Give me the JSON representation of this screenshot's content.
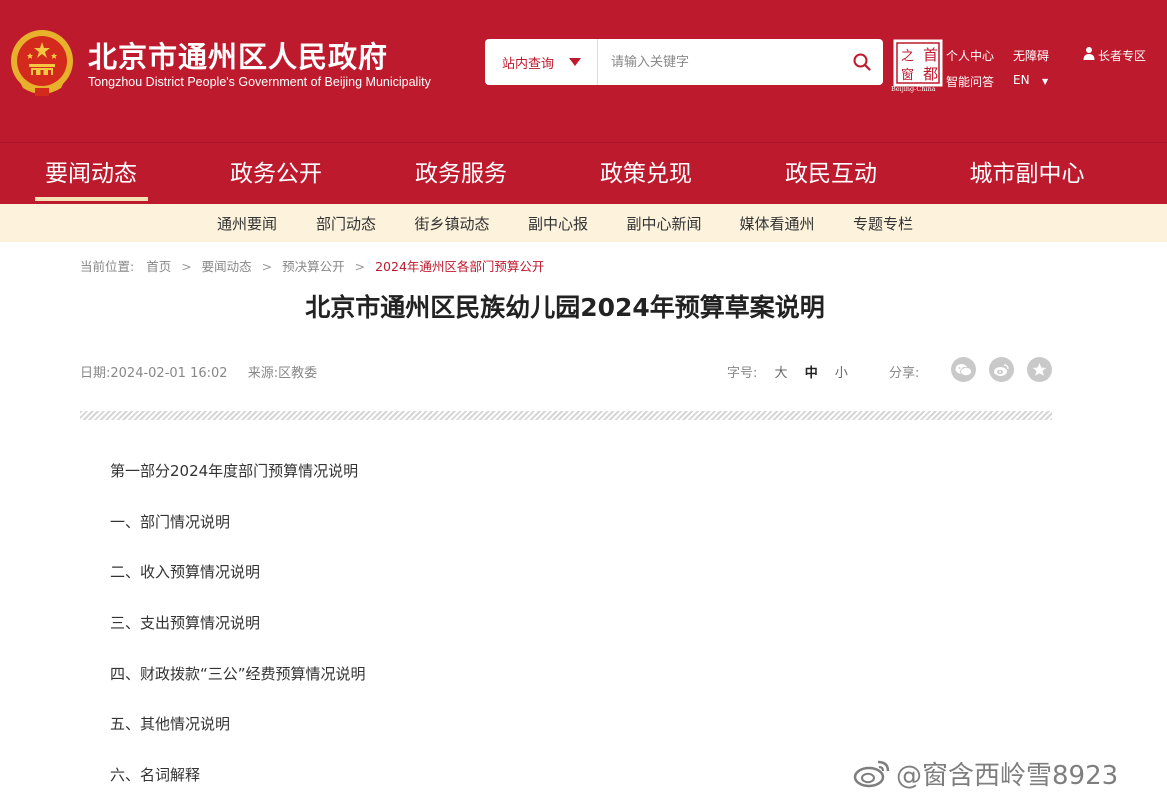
{
  "header": {
    "title": "北京市通州区人民政府",
    "subtitle": "Tongzhou District People's Government of Beijing Municipality",
    "search": {
      "scope_label": "站内查询",
      "placeholder": "请输入关键字",
      "value": ""
    },
    "capital_logo": {
      "chars": [
        "首",
        "之",
        "都",
        "窗"
      ],
      "caption": "Beijing-China"
    },
    "links": {
      "personal_center": "个人中心",
      "accessibility": "无障碍",
      "smart_qa": "智能问答",
      "language": "EN",
      "elder_zone": "长者专区"
    },
    "colors": {
      "brand_red": "#be1a2d",
      "subnav_bg": "#fdf3dd",
      "active_underline": "#f7e0b5"
    }
  },
  "main_nav": {
    "items": [
      "要闻动态",
      "政务公开",
      "政务服务",
      "政策兑现",
      "政民互动",
      "城市副中心"
    ],
    "active_index": 0
  },
  "sub_nav": {
    "items": [
      "通州要闻",
      "部门动态",
      "街乡镇动态",
      "副中心报",
      "副中心新闻",
      "媒体看通州",
      "专题专栏"
    ]
  },
  "breadcrumb": {
    "label": "当前位置:",
    "items": [
      "首页",
      "要闻动态",
      "预决算公开",
      "2024年通州区各部门预算公开"
    ]
  },
  "article": {
    "title": "北京市通州区民族幼儿园2024年预算草案说明",
    "date_label": "日期:",
    "date": "2024-02-01 16:02",
    "source_label": "来源:",
    "source": "区教委",
    "font_size_label": "字号:",
    "font_sizes": [
      "大",
      "中",
      "小"
    ],
    "share_label": "分享:",
    "share_icons": [
      "wechat-icon",
      "weibo-icon",
      "favorite-icon"
    ],
    "paragraphs": [
      "第一部分2024年度部门预算情况说明",
      "一、部门情况说明",
      "二、收入预算情况说明",
      "三、支出预算情况说明",
      "四、财政拨款“三公”经费预算情况说明",
      "五、其他情况说明",
      "六、名词解释"
    ]
  },
  "watermark": {
    "text": "@窗含西岭雪8923"
  }
}
